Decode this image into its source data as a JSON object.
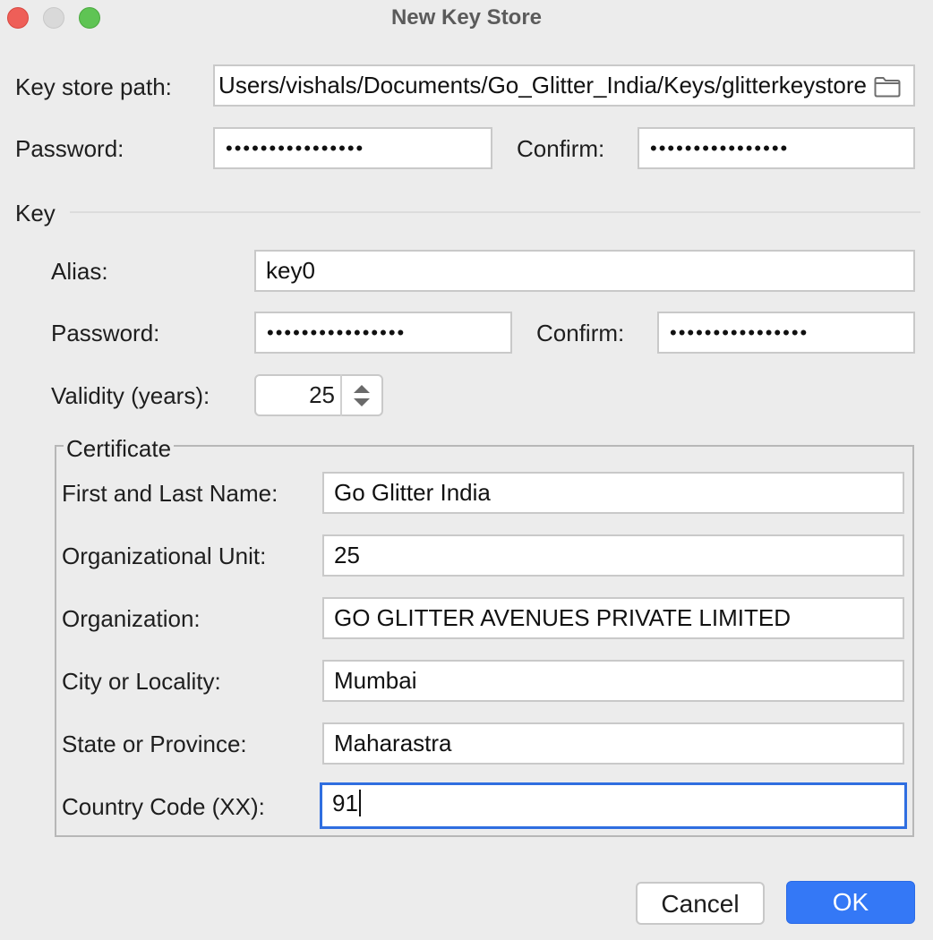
{
  "window": {
    "title": "New Key Store"
  },
  "keystore": {
    "path_label": "Key store path:",
    "path_value": "/Users/vishals/Documents/Go_Glitter_India/Keys/glitterkeystore",
    "password_label": "Password:",
    "password_value": "••••••••••••••••",
    "confirm_label": "Confirm:",
    "confirm_value": "••••••••••••••••"
  },
  "key": {
    "section_label": "Key",
    "alias_label": "Alias:",
    "alias_value": "key0",
    "password_label": "Password:",
    "password_value": "••••••••••••••••",
    "confirm_label": "Confirm:",
    "confirm_value": "••••••••••••••••",
    "validity_label": "Validity (years):",
    "validity_value": "25"
  },
  "certificate": {
    "legend": "Certificate",
    "name_label": "First and Last Name:",
    "name_value": "Go Glitter India",
    "unit_label": "Organizational Unit:",
    "unit_value": "25",
    "org_label": "Organization:",
    "org_value": "GO GLITTER AVENUES PRIVATE LIMITED",
    "city_label": "City or Locality:",
    "city_value": "Mumbai",
    "state_label": "State or Province:",
    "state_value": "Maharastra",
    "country_label": "Country Code (XX):",
    "country_value": "91"
  },
  "buttons": {
    "cancel": "Cancel",
    "ok": "OK"
  },
  "icons": {
    "folder": "folder-icon",
    "spinner_up": "chevron-up-icon",
    "spinner_down": "chevron-down-icon"
  },
  "colors": {
    "accent": "#3478f6",
    "focus_ring": "#2f6ee0",
    "window_bg": "#ececec"
  }
}
